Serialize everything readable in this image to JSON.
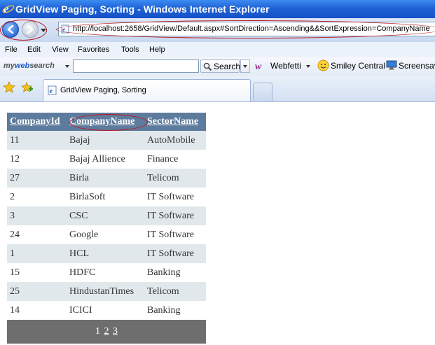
{
  "window": {
    "title": "GridView Paging, Sorting - Windows Internet Explorer"
  },
  "address_bar": {
    "url": "http://localhost:2658/GridView/Default.aspx#SortDirection=Ascending&&SortExpression=CompanyName"
  },
  "menu": {
    "items": [
      "File",
      "Edit",
      "View",
      "Favorites",
      "Tools",
      "Help"
    ]
  },
  "search_toolbar": {
    "logo_my": "my",
    "logo_web": "web",
    "logo_search": "search",
    "search_value": "",
    "search_label": "Search",
    "webfetti_label": "Webfetti",
    "smiley_label": "Smiley Central",
    "screensaver_label": "Screensave"
  },
  "tabs": {
    "active_label": "GridView Paging, Sorting"
  },
  "grid": {
    "headers": [
      "CompanyId",
      "CompanyName",
      "SectorName"
    ],
    "rows": [
      [
        "11",
        "Bajaj",
        "AutoMobile"
      ],
      [
        "12",
        "Bajaj Allience",
        "Finance"
      ],
      [
        "27",
        "Birla",
        "Telicom"
      ],
      [
        "2",
        "BirlaSoft",
        "IT Software"
      ],
      [
        "3",
        "CSC",
        "IT Software"
      ],
      [
        "24",
        "Google",
        "IT Software"
      ],
      [
        "1",
        "HCL",
        "IT Software"
      ],
      [
        "15",
        "HDFC",
        "Banking"
      ],
      [
        "25",
        "HindustanTimes",
        "Telicom"
      ],
      [
        "14",
        "ICICI",
        "Banking"
      ]
    ],
    "pager": {
      "current": "1",
      "pages": [
        "2",
        "3"
      ]
    }
  },
  "colors": {
    "header_bg": "#5d7b9d",
    "alt_row_bg": "#e1e8ec",
    "pager_bg": "#6e6e6e",
    "annotation": "#c0161e"
  }
}
